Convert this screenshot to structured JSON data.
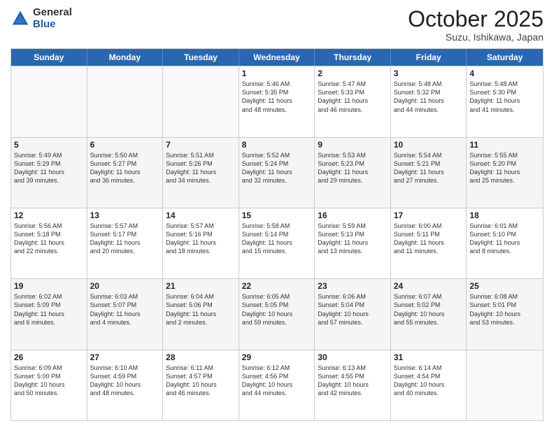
{
  "logo": {
    "general": "General",
    "blue": "Blue"
  },
  "title": {
    "month": "October 2025",
    "location": "Suzu, Ishikawa, Japan"
  },
  "weekdays": [
    "Sunday",
    "Monday",
    "Tuesday",
    "Wednesday",
    "Thursday",
    "Friday",
    "Saturday"
  ],
  "rows": [
    [
      {
        "day": "",
        "info": ""
      },
      {
        "day": "",
        "info": ""
      },
      {
        "day": "",
        "info": ""
      },
      {
        "day": "1",
        "info": "Sunrise: 5:46 AM\nSunset: 5:35 PM\nDaylight: 11 hours\nand 48 minutes."
      },
      {
        "day": "2",
        "info": "Sunrise: 5:47 AM\nSunset: 5:33 PM\nDaylight: 11 hours\nand 46 minutes."
      },
      {
        "day": "3",
        "info": "Sunrise: 5:48 AM\nSunset: 5:32 PM\nDaylight: 11 hours\nand 44 minutes."
      },
      {
        "day": "4",
        "info": "Sunrise: 5:48 AM\nSunset: 5:30 PM\nDaylight: 11 hours\nand 41 minutes."
      }
    ],
    [
      {
        "day": "5",
        "info": "Sunrise: 5:49 AM\nSunset: 5:29 PM\nDaylight: 11 hours\nand 39 minutes."
      },
      {
        "day": "6",
        "info": "Sunrise: 5:50 AM\nSunset: 5:27 PM\nDaylight: 11 hours\nand 36 minutes."
      },
      {
        "day": "7",
        "info": "Sunrise: 5:51 AM\nSunset: 5:26 PM\nDaylight: 11 hours\nand 34 minutes."
      },
      {
        "day": "8",
        "info": "Sunrise: 5:52 AM\nSunset: 5:24 PM\nDaylight: 11 hours\nand 32 minutes."
      },
      {
        "day": "9",
        "info": "Sunrise: 5:53 AM\nSunset: 5:23 PM\nDaylight: 11 hours\nand 29 minutes."
      },
      {
        "day": "10",
        "info": "Sunrise: 5:54 AM\nSunset: 5:21 PM\nDaylight: 11 hours\nand 27 minutes."
      },
      {
        "day": "11",
        "info": "Sunrise: 5:55 AM\nSunset: 5:20 PM\nDaylight: 11 hours\nand 25 minutes."
      }
    ],
    [
      {
        "day": "12",
        "info": "Sunrise: 5:56 AM\nSunset: 5:18 PM\nDaylight: 11 hours\nand 22 minutes."
      },
      {
        "day": "13",
        "info": "Sunrise: 5:57 AM\nSunset: 5:17 PM\nDaylight: 11 hours\nand 20 minutes."
      },
      {
        "day": "14",
        "info": "Sunrise: 5:57 AM\nSunset: 5:16 PM\nDaylight: 11 hours\nand 18 minutes."
      },
      {
        "day": "15",
        "info": "Sunrise: 5:58 AM\nSunset: 5:14 PM\nDaylight: 11 hours\nand 15 minutes."
      },
      {
        "day": "16",
        "info": "Sunrise: 5:59 AM\nSunset: 5:13 PM\nDaylight: 11 hours\nand 13 minutes."
      },
      {
        "day": "17",
        "info": "Sunrise: 6:00 AM\nSunset: 5:11 PM\nDaylight: 11 hours\nand 11 minutes."
      },
      {
        "day": "18",
        "info": "Sunrise: 6:01 AM\nSunset: 5:10 PM\nDaylight: 11 hours\nand 8 minutes."
      }
    ],
    [
      {
        "day": "19",
        "info": "Sunrise: 6:02 AM\nSunset: 5:09 PM\nDaylight: 11 hours\nand 6 minutes."
      },
      {
        "day": "20",
        "info": "Sunrise: 6:03 AM\nSunset: 5:07 PM\nDaylight: 11 hours\nand 4 minutes."
      },
      {
        "day": "21",
        "info": "Sunrise: 6:04 AM\nSunset: 5:06 PM\nDaylight: 11 hours\nand 2 minutes."
      },
      {
        "day": "22",
        "info": "Sunrise: 6:05 AM\nSunset: 5:05 PM\nDaylight: 10 hours\nand 59 minutes."
      },
      {
        "day": "23",
        "info": "Sunrise: 6:06 AM\nSunset: 5:04 PM\nDaylight: 10 hours\nand 57 minutes."
      },
      {
        "day": "24",
        "info": "Sunrise: 6:07 AM\nSunset: 5:02 PM\nDaylight: 10 hours\nand 55 minutes."
      },
      {
        "day": "25",
        "info": "Sunrise: 6:08 AM\nSunset: 5:01 PM\nDaylight: 10 hours\nand 53 minutes."
      }
    ],
    [
      {
        "day": "26",
        "info": "Sunrise: 6:09 AM\nSunset: 5:00 PM\nDaylight: 10 hours\nand 50 minutes."
      },
      {
        "day": "27",
        "info": "Sunrise: 6:10 AM\nSunset: 4:59 PM\nDaylight: 10 hours\nand 48 minutes."
      },
      {
        "day": "28",
        "info": "Sunrise: 6:11 AM\nSunset: 4:57 PM\nDaylight: 10 hours\nand 46 minutes."
      },
      {
        "day": "29",
        "info": "Sunrise: 6:12 AM\nSunset: 4:56 PM\nDaylight: 10 hours\nand 44 minutes."
      },
      {
        "day": "30",
        "info": "Sunrise: 6:13 AM\nSunset: 4:55 PM\nDaylight: 10 hours\nand 42 minutes."
      },
      {
        "day": "31",
        "info": "Sunrise: 6:14 AM\nSunset: 4:54 PM\nDaylight: 10 hours\nand 40 minutes."
      },
      {
        "day": "",
        "info": ""
      }
    ]
  ]
}
